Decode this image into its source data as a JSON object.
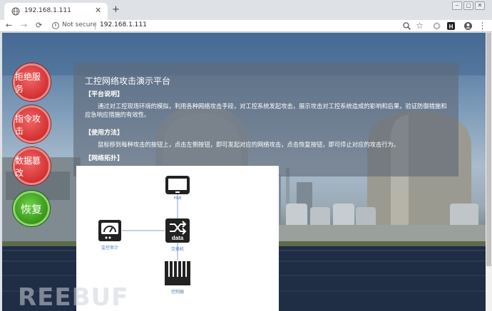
{
  "browser": {
    "tab_title": "192.168.1.111",
    "new_tab_glyph": "+",
    "tab_close_glyph": "✕",
    "back_glyph": "←",
    "forward_glyph": "→",
    "reload_glyph": "⟳",
    "security_label": "Not secure",
    "url": "192.168.1.111"
  },
  "sidebar": {
    "buttons": [
      {
        "label": "拒绝服务"
      },
      {
        "label": "指令攻击"
      },
      {
        "label": "数据篡改"
      },
      {
        "label": "恢复"
      }
    ]
  },
  "panel": {
    "title": "工控网络攻击演示平台",
    "intro_heading": "【平台说明】",
    "intro_text": "通过对工控现场环境的模拟，利用各种网络攻击手段，对工控系统发起攻击，展示攻击对工控系统造成的影响和后果，验证防御措施和应急响应措施的有效性。",
    "usage_heading": "【使用方法】",
    "usage_text": "鼠标移到每种攻击的按钮上，点击左侧按钮，即可发起对应的网络攻击，点击恢复按钮，即可停止对应的攻击行为。",
    "topology_heading": "【网络拓扑】"
  },
  "topology": {
    "hmi_label": "HMI",
    "switch_label": "交换机",
    "switch_inner_text": "data",
    "monitor_label": "监控审计",
    "controller_label": "控制器"
  },
  "watermark": "REEBUF",
  "colors": {
    "attack_button": "#d83838",
    "recover_button": "#3e9f1f",
    "topology_label": "#4f7fc0"
  }
}
